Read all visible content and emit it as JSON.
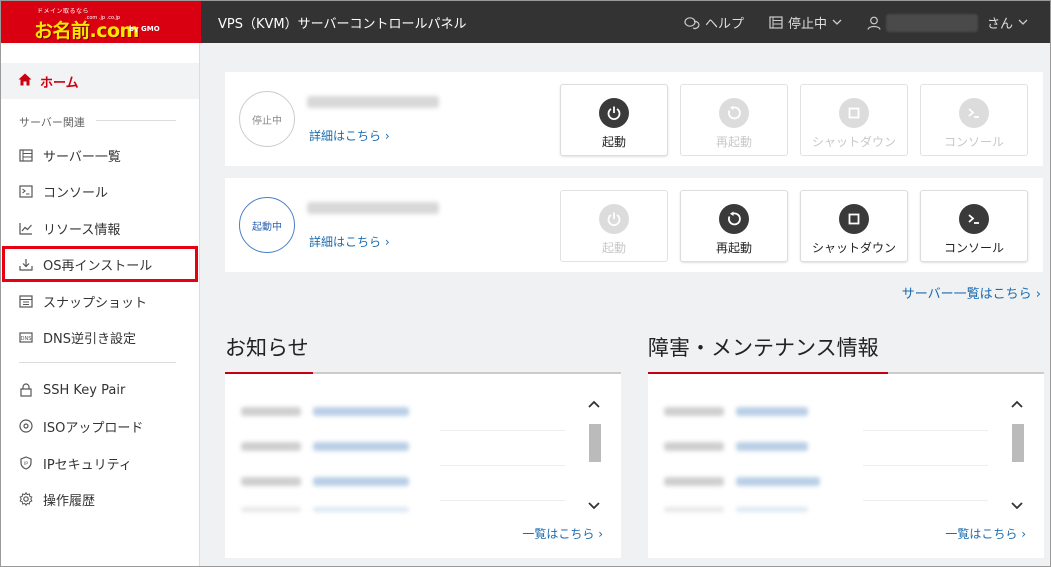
{
  "header": {
    "logo_tagline": "ドメイン取るなら",
    "logo_tlds": ".com .jp .co.jp",
    "logo_brand": "お名前.com",
    "logo_gmo": "by GMO",
    "title": "VPS（KVM）サーバーコントロールパネル",
    "help_label": "ヘルプ",
    "status_menu_label": "停止中",
    "user_suffix": "さん"
  },
  "sidebar": {
    "home_label": "ホーム",
    "section_label": "サーバー関連",
    "items": [
      {
        "label": "サーバー一覧",
        "icon": "server-list-icon"
      },
      {
        "label": "コンソール",
        "icon": "console-icon"
      },
      {
        "label": "リソース情報",
        "icon": "chart-icon"
      },
      {
        "label": "OS再インストール",
        "icon": "download-icon"
      },
      {
        "label": "スナップショット",
        "icon": "snapshot-icon"
      },
      {
        "label": "DNS逆引き設定",
        "icon": "dns-icon"
      },
      {
        "label": "SSH Key Pair",
        "icon": "lock-icon"
      },
      {
        "label": "ISOアップロード",
        "icon": "disc-icon"
      },
      {
        "label": "IPセキュリティ",
        "icon": "shield-icon"
      },
      {
        "label": "操作履歴",
        "icon": "gear-icon"
      }
    ]
  },
  "servers": [
    {
      "status": "停止中",
      "detail_link": "詳細はこちら ›",
      "buttons": [
        {
          "label": "起動",
          "icon": "power-icon",
          "enabled": true
        },
        {
          "label": "再起動",
          "icon": "restart-icon",
          "enabled": false
        },
        {
          "label": "シャットダウン",
          "icon": "stop-icon",
          "enabled": false
        },
        {
          "label": "コンソール",
          "icon": "console-icon",
          "enabled": false
        }
      ]
    },
    {
      "status": "起動中",
      "detail_link": "詳細はこちら ›",
      "buttons": [
        {
          "label": "起動",
          "icon": "power-icon",
          "enabled": false
        },
        {
          "label": "再起動",
          "icon": "restart-icon",
          "enabled": true
        },
        {
          "label": "シャットダウン",
          "icon": "stop-icon",
          "enabled": true
        },
        {
          "label": "コンソール",
          "icon": "console-icon",
          "enabled": true
        }
      ]
    }
  ],
  "server_list_link": "サーバー一覧はこちら ›",
  "news": {
    "title": "お知らせ",
    "list_link": "一覧はこちら ›"
  },
  "maintenance": {
    "title": "障害・メンテナンス情報",
    "list_link": "一覧はこちら ›"
  },
  "colors": {
    "brand_red": "#d90012",
    "header_bg": "#333333",
    "link_blue": "#1a6bb0",
    "highlight_red": "#e60012"
  }
}
